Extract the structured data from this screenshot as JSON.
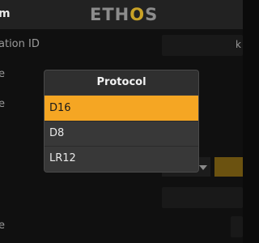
{
  "header": {
    "title": "m",
    "logo": {
      "text_before": "ETH",
      "text_accent": "O",
      "text_after": "S"
    }
  },
  "background_rows": [
    {
      "label": "ation ID",
      "value": "k"
    },
    {
      "label": "e"
    },
    {
      "label": "e"
    },
    {
      "label": ""
    },
    {
      "label": ""
    },
    {
      "label": ""
    },
    {
      "label": "e"
    }
  ],
  "popup": {
    "title": "Protocol",
    "options": [
      {
        "label": "D16",
        "selected": true
      },
      {
        "label": "D8",
        "selected": false
      },
      {
        "label": "LR12",
        "selected": false
      }
    ]
  },
  "colors": {
    "accent": "#f5a623",
    "logo_accent": "#c9a227",
    "background": "#0b0b0b",
    "popup": "#383838"
  }
}
